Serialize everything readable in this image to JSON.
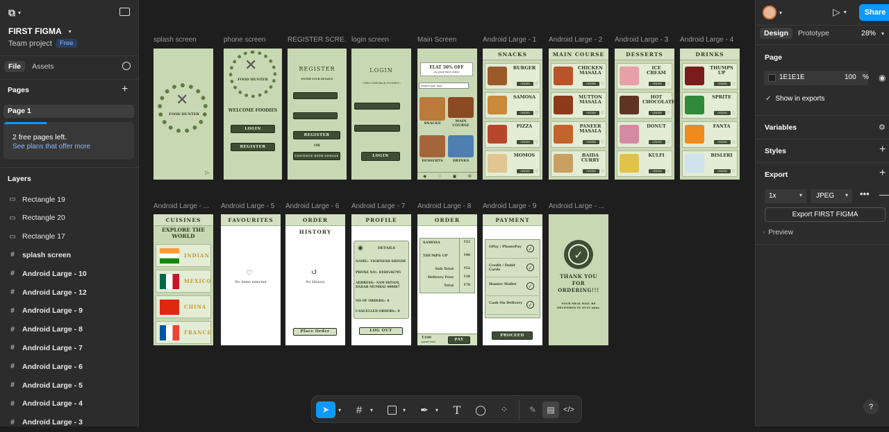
{
  "app": {
    "file_name": "FIRST FIGMA",
    "team": "Team project",
    "plan_badge": "Free"
  },
  "left_tabs": {
    "file": "File",
    "assets": "Assets"
  },
  "pages": {
    "title": "Pages",
    "items": [
      "Page 1"
    ],
    "notice": "2 free pages left.",
    "notice_link": "See plans that offer more"
  },
  "layers": {
    "title": "Layers",
    "items": [
      {
        "label": "Rectangle 19",
        "icon": "rectangle-icon"
      },
      {
        "label": "Rectangle 20",
        "icon": "rectangle-icon"
      },
      {
        "label": "Rectangle 17",
        "icon": "rectangle-icon"
      },
      {
        "label": "splash screen",
        "icon": "frame-icon"
      },
      {
        "label": "Android Large - 10",
        "icon": "frame-icon"
      },
      {
        "label": "Android Large - 12",
        "icon": "frame-icon"
      },
      {
        "label": "Android Large - 9",
        "icon": "frame-icon"
      },
      {
        "label": "Android Large - 8",
        "icon": "frame-icon"
      },
      {
        "label": "Android Large - 7",
        "icon": "frame-icon"
      },
      {
        "label": "Android Large - 6",
        "icon": "frame-icon"
      },
      {
        "label": "Android Large - 5",
        "icon": "frame-icon"
      },
      {
        "label": "Android Large - 4",
        "icon": "frame-icon"
      },
      {
        "label": "Android Large - 3",
        "icon": "frame-icon"
      }
    ]
  },
  "right": {
    "share": "Share",
    "tab_design": "Design",
    "tab_prototype": "Prototype",
    "zoom": "28%",
    "page_section": "Page",
    "bg_hex": "1E1E1E",
    "bg_opacity": "100",
    "bg_opacity_unit": "%",
    "show_in_exports": "Show in exports",
    "variables": "Variables",
    "styles": "Styles",
    "export": "Export",
    "export_scale": "1x",
    "export_format": "JPEG",
    "export_button": "Export FIRST FIGMA",
    "preview": "Preview",
    "help": "?"
  },
  "frames_row1": [
    "splash screen",
    "phone screen",
    "REGISTER SCRE...",
    "login screen",
    "Main Screen",
    "Android Large - 1",
    "Android Large - 2",
    "Android Large - 3",
    "Android Large - 4"
  ],
  "frames_row2": [
    "Android Large - ...",
    "Android Large - 5",
    "Android Large - 6",
    "Android Large - 7",
    "Android Large - 8",
    "Android Large - 9",
    "Android Large - ..."
  ],
  "screens": {
    "logo_text": "FOOD HUNTER",
    "welcome": "WELCOME FOODIES",
    "login": "LOGIN",
    "register": "REGISTER",
    "enter_details": "ENTER YOUR DETAILS",
    "or": "OR",
    "google": "CONTINUE WITH GOOGLE",
    "welcome_back": "( WELCOME BACK FOODIES )",
    "flat_offer": "FLAT 50% OFF",
    "first_order": "on your first order",
    "search": "Search your food",
    "snacks": "SNACKS",
    "main_course": "MAIN COURSE",
    "desserts": "DESSERTS",
    "drinks": "DRINKS",
    "order": "ORDER",
    "snacks_items": [
      "BURGER",
      "SAMOSA",
      "PIZZA",
      "MOMOS"
    ],
    "main_items": [
      "CHICKEN MASALA",
      "MUTTON MASALA",
      "PANEER MASALA",
      "BAIDA CURRY"
    ],
    "dessert_items": [
      "ICE CREAM",
      "HOT CHOCOLATE",
      "DONUT",
      "KULFI"
    ],
    "drink_items": [
      "THUMPS UP",
      "SPRITE",
      "FANTA",
      "BISLERI"
    ],
    "cuisines": "CUISINES",
    "explore": "EXPLORE THE WORLD",
    "cuisine_items": [
      "INDIAN",
      "MEXICO",
      "CHINA",
      "FRANCE"
    ],
    "favourites": "FAVOURITES",
    "no_items": "No items selected",
    "order_history": "ORDER HISTORY",
    "no_history": "No History",
    "place_order": "Place Order",
    "profile": "PROFILE",
    "details": "DETAILS",
    "profile_name": "NAME:- VIGHNESH SHINDE",
    "profile_phone": "PHONE NO:- 8169546795",
    "profile_address": "ADDRESS:- SAM SHYAM, DADAR MUMBAI 400087",
    "profile_orders": "NO OF ORDERS:- 0",
    "profile_cancelled": "CANCELLED ORDERS:- 0",
    "logout": "LOG OUT",
    "order_title": "ORDER",
    "order_lines": [
      {
        "name": "SAMOSA",
        "price": "₹12"
      },
      {
        "name": "THUMPS UP",
        "price": "₹40"
      },
      {
        "name": "Sub Total",
        "price": "₹52"
      },
      {
        "name": "Delivery Fees",
        "price": "₹18"
      },
      {
        "name": "Total",
        "price": "₹70"
      }
    ],
    "grand": "₹100",
    "grand_label": "grand total",
    "pay": "PAY",
    "payment": "PAYMENT",
    "pay_options": [
      "GPay / PhonePay",
      "Credit / Debit Cards",
      "Hunter Wallet",
      "Cash On Delivery"
    ],
    "proceed": "PROCEED",
    "thank_you": "THANK YOU FOR ORDERING!!!",
    "delivered": "YOUR MEAL WILL BE DELIVERED IN 20-25 mins."
  }
}
